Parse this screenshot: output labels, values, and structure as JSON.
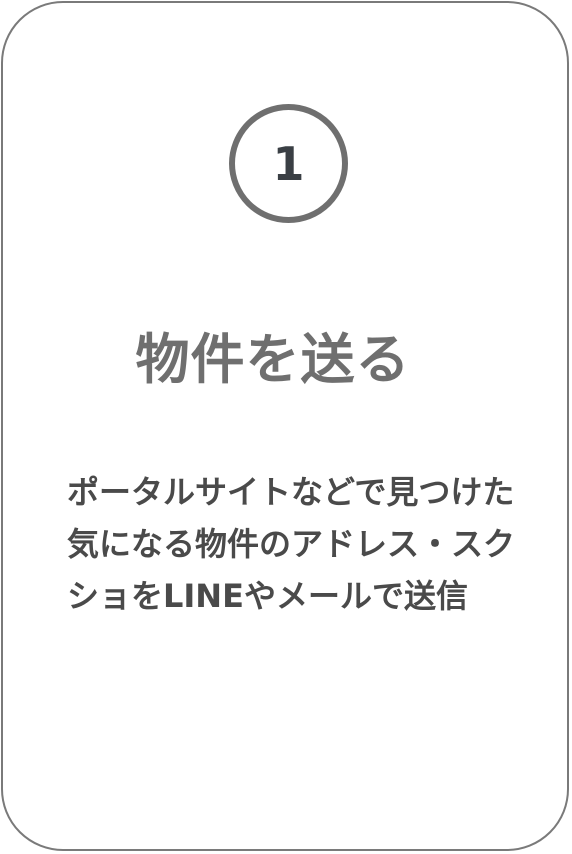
{
  "card": {
    "step_number": "1",
    "title": "物件を送る",
    "description": "ポータルサイトなどで見つけた気になる物件のアドレス・スクショをLINEやメールで送信"
  }
}
